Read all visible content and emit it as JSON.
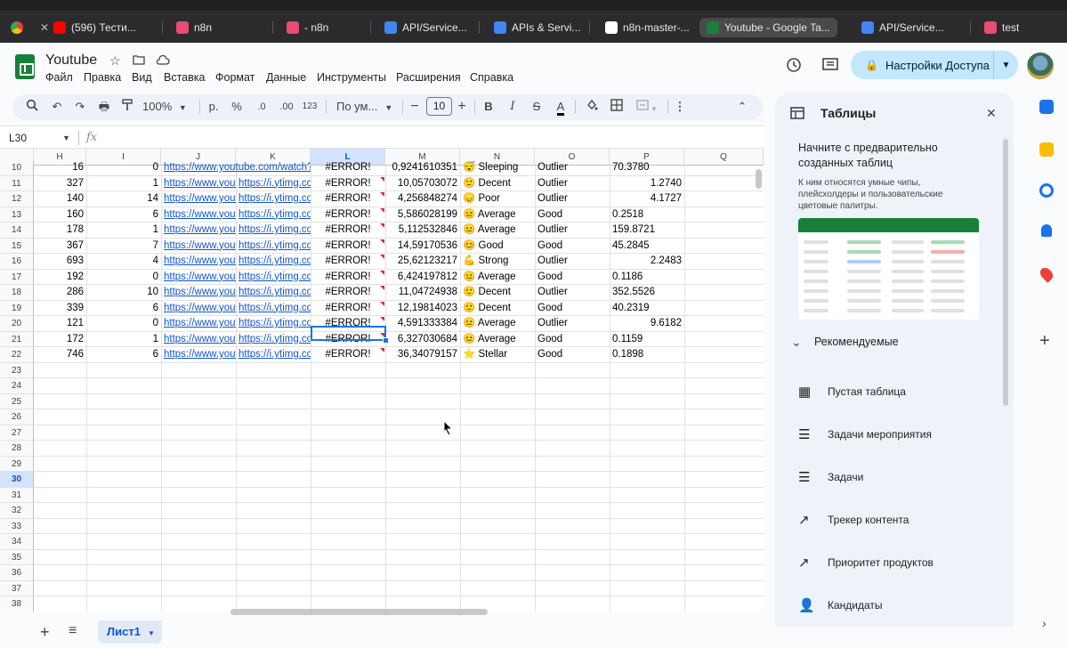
{
  "browser": {
    "tabs": [
      {
        "label": "(596) Тести...",
        "color": "#ff0000"
      },
      {
        "label": "n8n",
        "color": "#ea4b71"
      },
      {
        "label": "- n8n",
        "color": "#ea4b71"
      },
      {
        "label": "API/Service...",
        "color": "#4285f4"
      },
      {
        "label": "APIs & Servi...",
        "color": "#4285f4"
      },
      {
        "label": "n8n-master-...",
        "color": "#ffffff"
      },
      {
        "label": "Youtube - Google Ta...",
        "color": "#188038"
      },
      {
        "label": "API/Service...",
        "color": "#4285f4"
      },
      {
        "label": "test",
        "color": "#ea4b71"
      }
    ]
  },
  "app": {
    "title": "Youtube",
    "menu": [
      "Файл",
      "Правка",
      "Вид",
      "Вставка",
      "Формат",
      "Данные",
      "Инструменты",
      "Расширения",
      "Справка"
    ],
    "share_label": "Настройки Доступа"
  },
  "toolbar": {
    "zoom": "100%",
    "currency": "р.",
    "percent": "%",
    "dec_minus": ".0",
    "dec_plus": ".00",
    "number_format": "123",
    "font": "По ум...",
    "font_size": "10",
    "bold": "B",
    "italic": "I",
    "text_color": "A"
  },
  "formula_bar": {
    "cell_ref": "L30",
    "fx": "fx"
  },
  "sheet": {
    "columns": [
      "H",
      "I",
      "J",
      "K",
      "L",
      "M",
      "N",
      "O",
      "P",
      "Q"
    ],
    "selected_column": "L",
    "selected_row": "30",
    "row_numbers": [
      "10",
      "11",
      "12",
      "13",
      "14",
      "15",
      "16",
      "17",
      "18",
      "19",
      "20",
      "21",
      "22",
      "23",
      "24",
      "25",
      "26",
      "27",
      "28",
      "29",
      "30",
      "31",
      "32",
      "33",
      "34",
      "35",
      "36",
      "37",
      "38"
    ],
    "rows": [
      {
        "h": "16",
        "i": "0",
        "j": "https://www.youtube.com/watch?v",
        "k": "",
        "l": "#ERROR!",
        "m": "0,9241610351",
        "n": "😴 Sleeping",
        "o": "Outlier",
        "p": "70.3780",
        "p_align": "left"
      },
      {
        "h": "327",
        "i": "1",
        "j": "https://www.yout",
        "k": "https://i.ytimg.co",
        "l": "#ERROR!",
        "m": "10,05703072",
        "n": "🙂 Decent",
        "o": "Outlier",
        "p": "1.2740",
        "p_align": "right"
      },
      {
        "h": "140",
        "i": "14",
        "j": "https://www.yout",
        "k": "https://i.ytimg.co",
        "l": "#ERROR!",
        "m": "4,256848274",
        "n": "😞 Poor",
        "o": "Outlier",
        "p": "4.1727",
        "p_align": "right"
      },
      {
        "h": "160",
        "i": "6",
        "j": "https://www.yout",
        "k": "https://i.ytimg.co",
        "l": "#ERROR!",
        "m": "5,586028199",
        "n": "😐 Average",
        "o": "Good",
        "p": "0.2518",
        "p_align": "left"
      },
      {
        "h": "178",
        "i": "1",
        "j": "https://www.yout",
        "k": "https://i.ytimg.co",
        "l": "#ERROR!",
        "m": "5,112532846",
        "n": "😐 Average",
        "o": "Outlier",
        "p": "159.8721",
        "p_align": "left"
      },
      {
        "h": "367",
        "i": "7",
        "j": "https://www.yout",
        "k": "https://i.ytimg.co",
        "l": "#ERROR!",
        "m": "14,59170536",
        "n": "😊 Good",
        "o": "Good",
        "p": "45.2845",
        "p_align": "left"
      },
      {
        "h": "693",
        "i": "4",
        "j": "https://www.yout",
        "k": "https://i.ytimg.co",
        "l": "#ERROR!",
        "m": "25,62123217",
        "n": "💪 Strong",
        "o": "Outlier",
        "p": "2.2483",
        "p_align": "right"
      },
      {
        "h": "192",
        "i": "0",
        "j": "https://www.yout",
        "k": "https://i.ytimg.co",
        "l": "#ERROR!",
        "m": "6,424197812",
        "n": "😐 Average",
        "o": "Good",
        "p": "0.1186",
        "p_align": "left"
      },
      {
        "h": "286",
        "i": "10",
        "j": "https://www.yout",
        "k": "https://i.ytimg.co",
        "l": "#ERROR!",
        "m": "11,04724938",
        "n": "🙂 Decent",
        "o": "Outlier",
        "p": "352.5526",
        "p_align": "left"
      },
      {
        "h": "339",
        "i": "6",
        "j": "https://www.yout",
        "k": "https://i.ytimg.co",
        "l": "#ERROR!",
        "m": "12,19814023",
        "n": "🙂 Decent",
        "o": "Good",
        "p": "40.2319",
        "p_align": "left"
      },
      {
        "h": "121",
        "i": "0",
        "j": "https://www.yout",
        "k": "https://i.ytimg.co",
        "l": "#ERROR!",
        "m": "4,591333384",
        "n": "😐 Average",
        "o": "Outlier",
        "p": "9.6182",
        "p_align": "right"
      },
      {
        "h": "172",
        "i": "1",
        "j": "https://www.yout",
        "k": "https://i.ytimg.co",
        "l": "#ERROR!",
        "m": "6,327030684",
        "n": "😐 Average",
        "o": "Good",
        "p": "0.1159",
        "p_align": "left"
      },
      {
        "h": "746",
        "i": "6",
        "j": "https://www.yout",
        "k": "https://i.ytimg.co",
        "l": "#ERROR!",
        "m": "36,34079157",
        "n": "⭐ Stellar",
        "o": "Good",
        "p": "0.1898",
        "p_align": "left"
      }
    ],
    "sheet_tab": "Лист1"
  },
  "panel": {
    "title": "Таблицы",
    "intro": "Начните с предварительно созданных таблиц",
    "subtext": "К ним относятся умные чипы, плейсхолдеры и пользовательские цветовые палитры.",
    "recommended": "Рекомендуемые",
    "items": [
      {
        "label": "Пустая таблица",
        "icon": "table-icon"
      },
      {
        "label": "Задачи мероприятия",
        "icon": "checklist-icon"
      },
      {
        "label": "Задачи",
        "icon": "checklist-icon"
      },
      {
        "label": "Трекер контента",
        "icon": "trend-icon"
      },
      {
        "label": "Приоритет продуктов",
        "icon": "trend-icon"
      },
      {
        "label": "Кандидаты",
        "icon": "person-icon"
      }
    ]
  }
}
